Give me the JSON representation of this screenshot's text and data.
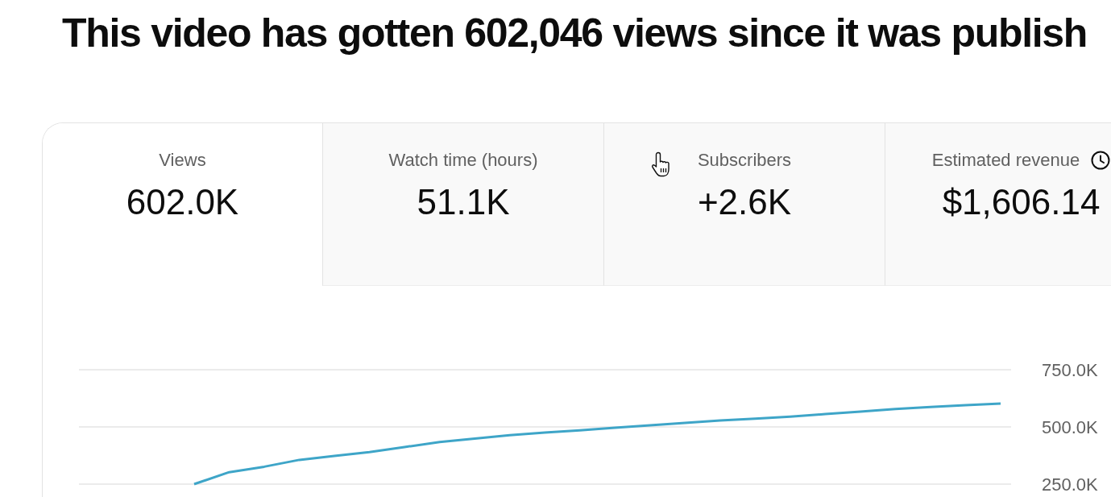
{
  "heading": "This video has gotten 602,046 views since it was publish",
  "tabs": [
    {
      "label": "Views",
      "value": "602.0K",
      "selected": true,
      "kind": "standard"
    },
    {
      "label": "Watch time (hours)",
      "value": "51.1K",
      "selected": false,
      "kind": "standard"
    },
    {
      "label": "Subscribers",
      "value": "+2.6K",
      "selected": false,
      "kind": "standard"
    },
    {
      "label": "Estimated revenue",
      "value": "$1,606.14",
      "selected": false,
      "kind": "estimate"
    }
  ],
  "chart": {
    "chart_data": {
      "type": "line",
      "ylim": [
        250000,
        750000
      ],
      "yticks": [
        {
          "value": 250000,
          "label": "250.0K"
        },
        {
          "value": 500000,
          "label": "500.0K"
        },
        {
          "value": 750000,
          "label": "750.0K"
        }
      ],
      "values": [
        250000,
        302000,
        326000,
        356000,
        373000,
        390000,
        412000,
        434000,
        449000,
        464000,
        475000,
        485000,
        496000,
        507000,
        518000,
        528000,
        536000,
        545000,
        556000,
        567000,
        578000,
        587000,
        595000,
        602000
      ]
    }
  }
}
